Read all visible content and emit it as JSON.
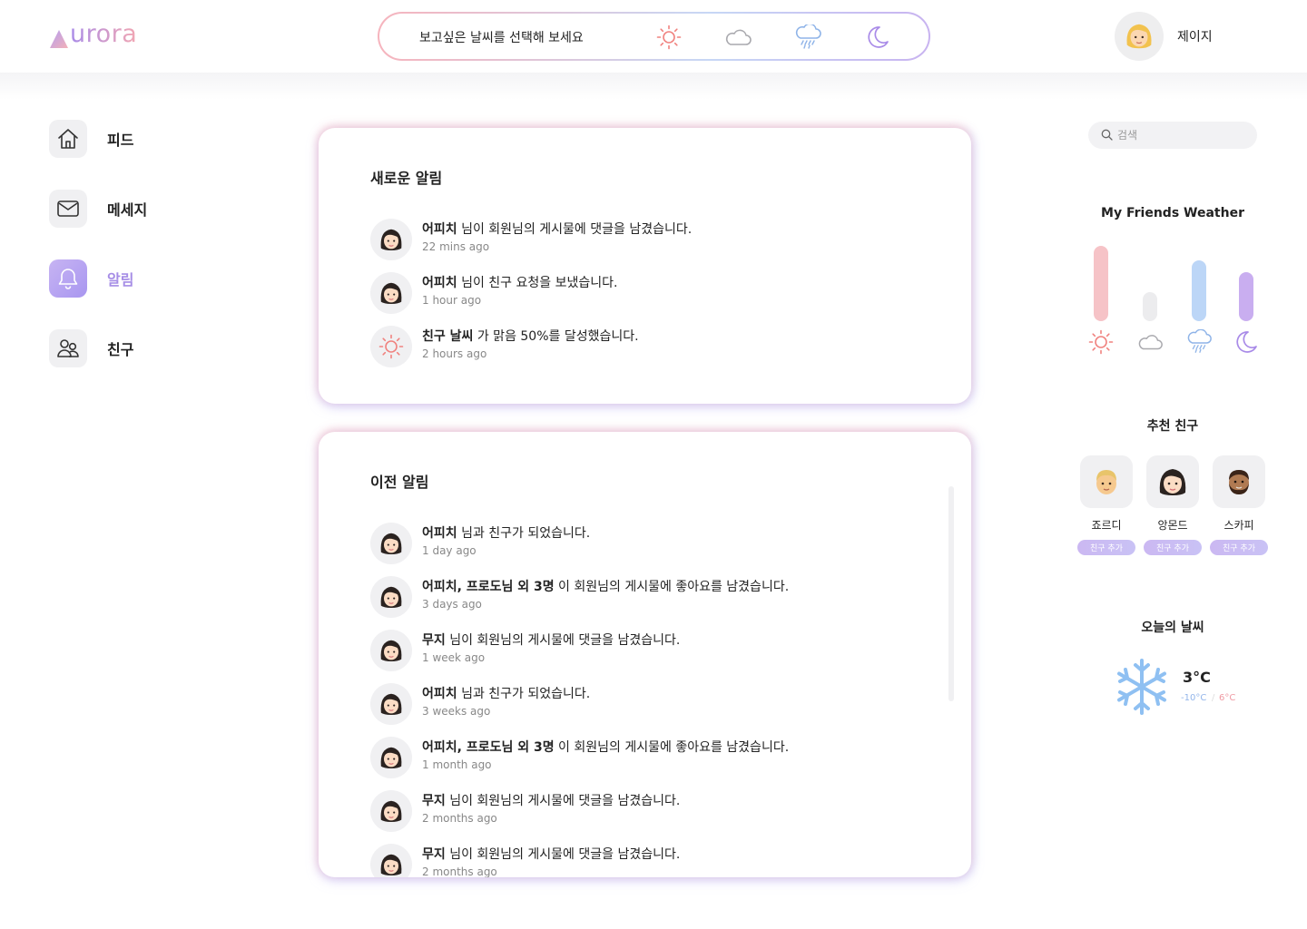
{
  "app": {
    "logo_text": "urora"
  },
  "header": {
    "select_prompt": "보고싶은 날씨를 선택해 보세요",
    "weather_options": [
      "sun-icon",
      "cloud-icon",
      "rain-cloud-icon",
      "moon-icon"
    ],
    "user_name": "제이지"
  },
  "sidebar": {
    "items": [
      {
        "label": "피드",
        "icon": "home-icon"
      },
      {
        "label": "메세지",
        "icon": "mail-icon"
      },
      {
        "label": "알림",
        "icon": "bell-icon",
        "active": true
      },
      {
        "label": "친구",
        "icon": "users-icon"
      }
    ]
  },
  "new_notifications": {
    "title": "새로운 알림",
    "items": [
      {
        "bold": "어피치",
        "text": " 님이 회원님의 게시물에 댓글을 남겼습니다.",
        "time": "22 mins ago",
        "avatar": "girl-avatar"
      },
      {
        "bold": "어피치",
        "text": " 님이 친구 요청을 보냈습니다.",
        "time": "1 hour ago",
        "avatar": "girl-avatar"
      },
      {
        "bold": "친구 날씨",
        "text": " 가 맑음 50%를 달성했습니다.",
        "time": "2 hours ago",
        "avatar": "sun-icon"
      }
    ]
  },
  "old_notifications": {
    "title": "이전 알림",
    "items": [
      {
        "bold": "어피치",
        "text": " 님과 친구가 되었습니다.",
        "time": "1 day ago"
      },
      {
        "bold": "어피치, 프로도님 외 3명",
        "text": " 이 회원님의 게시물에 좋아요를 남겼습니다.",
        "time": "3 days ago"
      },
      {
        "bold": "무지",
        "text": " 님이 회원님의 게시물에 댓글을 남겼습니다.",
        "time": "1 week ago"
      },
      {
        "bold": "어피치",
        "text": " 님과 친구가 되었습니다.",
        "time": "3 weeks ago"
      },
      {
        "bold": "어피치, 프로도님 외 3명",
        "text": " 이 회원님의 게시물에 좋아요를 남겼습니다.",
        "time": "1 month ago"
      },
      {
        "bold": "무지",
        "text": " 님이 회원님의 게시물에 댓글을 남겼습니다.",
        "time": "2 months ago"
      },
      {
        "bold": "무지",
        "text": " 님이 회원님의 게시물에 댓글을 남겼습니다.",
        "time": "2 months ago"
      }
    ]
  },
  "search": {
    "placeholder": "검색"
  },
  "friends_weather": {
    "title": "My Friends Weather",
    "bars": [
      {
        "weather": "sun-icon",
        "level": 0.52,
        "color": "#f6c3c7"
      },
      {
        "weather": "cloud-icon",
        "level": 0.2,
        "color": "#ececee"
      },
      {
        "weather": "rain-cloud-icon",
        "level": 0.42,
        "color": "#bcd6f7"
      },
      {
        "weather": "moon-icon",
        "level": 0.34,
        "color": "#c9aef0"
      }
    ]
  },
  "recommended": {
    "title": "추천 친구",
    "add_label": "친구 추가",
    "friends": [
      {
        "name": "죠르디",
        "avatar": "blond-man-avatar"
      },
      {
        "name": "앙몬드",
        "avatar": "girl-avatar"
      },
      {
        "name": "스카피",
        "avatar": "bearded-man-avatar"
      }
    ]
  },
  "today_weather": {
    "title": "오늘의 날씨",
    "icon": "snowflake-icon",
    "temp": "3°C",
    "low": "-10°C",
    "separator": "/",
    "high": "6°C"
  },
  "colors": {
    "accent_purple": "#a68de6",
    "sun": "#f0827f",
    "cloud": "#a9a9ae",
    "rain": "#8fb4e8",
    "moon": "#a98be8"
  }
}
